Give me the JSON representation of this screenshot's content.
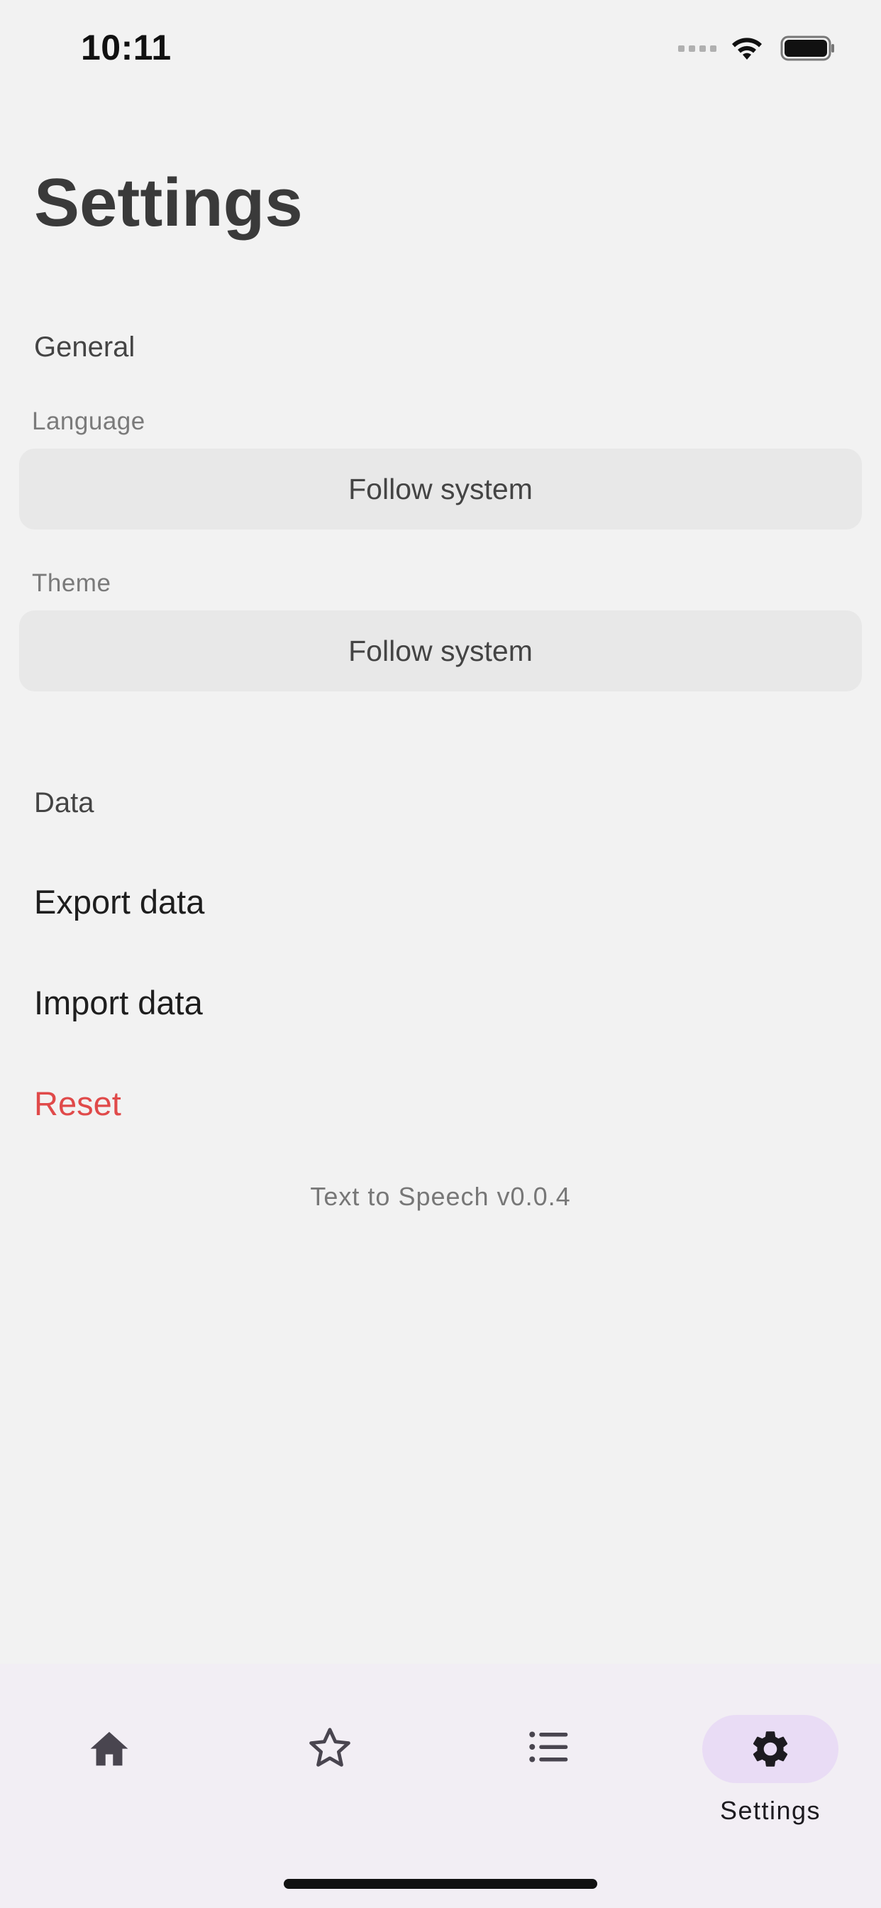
{
  "status_bar": {
    "time": "10:11"
  },
  "title": "Settings",
  "general": {
    "header": "General",
    "language": {
      "label": "Language",
      "value": "Follow system"
    },
    "theme": {
      "label": "Theme",
      "value": "Follow system"
    }
  },
  "data_section": {
    "header": "Data",
    "export_label": "Export data",
    "import_label": "Import data",
    "reset_label": "Reset"
  },
  "version": "Text to Speech v0.0.4",
  "bottom_nav": {
    "items": [
      {
        "icon": "home-icon",
        "label": ""
      },
      {
        "icon": "star-icon",
        "label": ""
      },
      {
        "icon": "list-icon",
        "label": ""
      },
      {
        "icon": "gear-icon",
        "label": "Settings",
        "active": true
      }
    ]
  },
  "colors": {
    "background": "#f2f2f2",
    "danger": "#e04a4a",
    "nav_background": "#f2eef4",
    "active_pill": "#e9dcf5"
  }
}
